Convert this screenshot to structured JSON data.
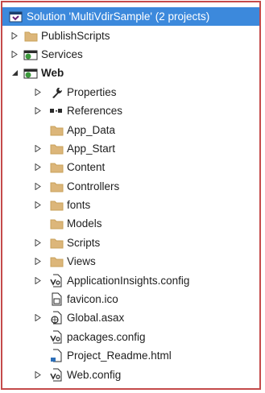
{
  "tree": {
    "solution": {
      "label": "Solution 'MultiVdirSample' (2 projects)",
      "icon": "solution-icon"
    },
    "items": [
      {
        "label": "PublishScripts",
        "icon": "folder-icon",
        "expander": "collapsed"
      },
      {
        "label": "Services",
        "icon": "web-project-icon",
        "expander": "collapsed"
      },
      {
        "label": "Web",
        "icon": "web-project-icon",
        "expander": "expanded"
      },
      {
        "label": "Properties",
        "icon": "wrench-icon",
        "expander": "collapsed"
      },
      {
        "label": "References",
        "icon": "references-icon",
        "expander": "collapsed"
      },
      {
        "label": "App_Data",
        "icon": "folder-icon",
        "expander": "none"
      },
      {
        "label": "App_Start",
        "icon": "folder-icon",
        "expander": "collapsed"
      },
      {
        "label": "Content",
        "icon": "folder-icon",
        "expander": "collapsed"
      },
      {
        "label": "Controllers",
        "icon": "folder-icon",
        "expander": "collapsed"
      },
      {
        "label": "fonts",
        "icon": "folder-icon",
        "expander": "collapsed"
      },
      {
        "label": "Models",
        "icon": "folder-icon",
        "expander": "none"
      },
      {
        "label": "Scripts",
        "icon": "folder-icon",
        "expander": "collapsed"
      },
      {
        "label": "Views",
        "icon": "folder-icon",
        "expander": "collapsed"
      },
      {
        "label": "ApplicationInsights.config",
        "icon": "config-file-icon",
        "expander": "collapsed"
      },
      {
        "label": "favicon.ico",
        "icon": "image-file-icon",
        "expander": "none"
      },
      {
        "label": "Global.asax",
        "icon": "global-asax-icon",
        "expander": "collapsed"
      },
      {
        "label": "packages.config",
        "icon": "config-file-icon",
        "expander": "none"
      },
      {
        "label": "Project_Readme.html",
        "icon": "html-file-icon",
        "expander": "none"
      },
      {
        "label": "Web.config",
        "icon": "config-file-icon",
        "expander": "collapsed"
      }
    ]
  },
  "colors": {
    "selection": "#3c89dc",
    "border": "#c44a4a",
    "folder": "#dcb67a"
  }
}
